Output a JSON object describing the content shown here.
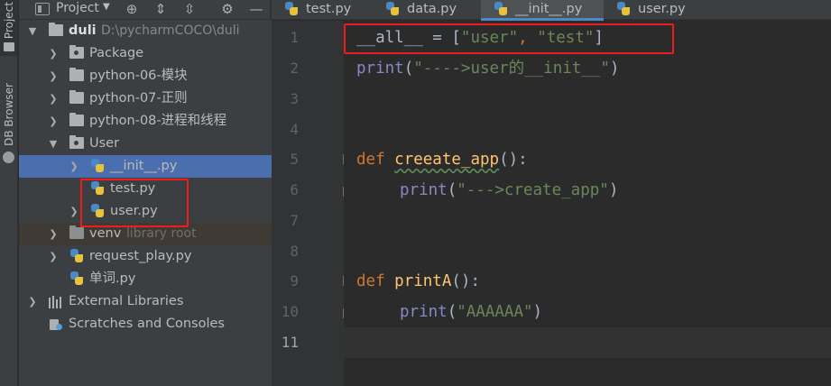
{
  "side_strip": {
    "project_label": "Project",
    "db_label": "DB Browser"
  },
  "project_panel": {
    "title": "Project",
    "tools": [
      "target-icon",
      "expand-all-icon",
      "collapse-all-icon",
      "gear-icon",
      "minimize-icon"
    ]
  },
  "tree": {
    "root": {
      "name": "duli",
      "path": "D:\\pycharmCOCO\\duli"
    },
    "items": [
      {
        "label": "Package"
      },
      {
        "label": "python-06-模块"
      },
      {
        "label": "python-07-正则"
      },
      {
        "label": "python-08-进程和线程"
      },
      {
        "label": "User"
      },
      {
        "label": "__init__.py"
      },
      {
        "label": "test.py"
      },
      {
        "label": "user.py"
      },
      {
        "label": "venv",
        "hint": "library root"
      },
      {
        "label": "request_play.py"
      },
      {
        "label": "单词.py"
      },
      {
        "label": "External Libraries"
      },
      {
        "label": "Scratches and Consoles"
      }
    ]
  },
  "editor": {
    "tabs": [
      {
        "label": "test.py",
        "active": false
      },
      {
        "label": "data.py",
        "active": false
      },
      {
        "label": "__init__.py",
        "active": true
      },
      {
        "label": "user.py",
        "active": false
      }
    ],
    "line_numbers": [
      "1",
      "2",
      "3",
      "4",
      "5",
      "6",
      "7",
      "8",
      "9",
      "10",
      "11"
    ],
    "code": {
      "l1_a": "__all__ = [",
      "l1_s1": "\"user\"",
      "l1_comma": ", ",
      "l1_s2": "\"test\"",
      "l1_b": "]",
      "l2_print": "print",
      "l2_open": "(",
      "l2_str": "\"---->user的__init__\"",
      "l2_close": ")",
      "l5_def": "def ",
      "l5_name": "creeate_app",
      "l5_rest": "():",
      "l6_print": "print",
      "l6_open": "(",
      "l6_str": "\"--->create_app\"",
      "l6_close": ")",
      "l9_def": "def ",
      "l9_name": "printA",
      "l9_rest": "():",
      "l10_print": "print",
      "l10_open": "(",
      "l10_str": "\"AAAAAA\"",
      "l10_close": ")"
    }
  },
  "colors": {
    "keyword": "#cc7832",
    "function": "#ffc66d",
    "string": "#6a8759",
    "builtin": "#8888c6",
    "selection": "#4b6eaf",
    "annotation": "#ee1c1c"
  }
}
